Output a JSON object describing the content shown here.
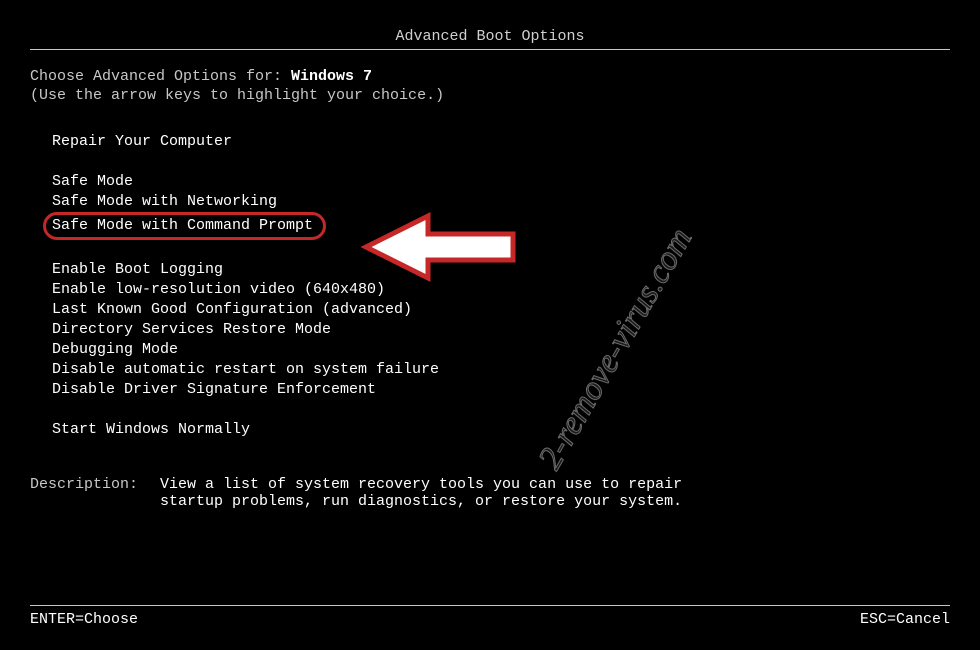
{
  "title": "Advanced Boot Options",
  "intro": {
    "prefix": "Choose Advanced Options for: ",
    "os": "Windows 7",
    "hint": "(Use the arrow keys to highlight your choice.)"
  },
  "menu": {
    "group1": [
      "Repair Your Computer"
    ],
    "group2": [
      "Safe Mode",
      "Safe Mode with Networking",
      "Safe Mode with Command Prompt"
    ],
    "group3": [
      "Enable Boot Logging",
      "Enable low-resolution video (640x480)",
      "Last Known Good Configuration (advanced)",
      "Directory Services Restore Mode",
      "Debugging Mode",
      "Disable automatic restart on system failure",
      "Disable Driver Signature Enforcement"
    ],
    "group4": [
      "Start Windows Normally"
    ],
    "highlighted_index": {
      "group": 2,
      "item": 2
    }
  },
  "description": {
    "label": "Description:",
    "text": "View a list of system recovery tools you can use to repair startup problems, run diagnostics, or restore your system."
  },
  "footer": {
    "enter": "ENTER=Choose",
    "esc": "ESC=Cancel"
  },
  "annotation": {
    "watermark": "2-remove-virus.com",
    "highlight_color": "#c62828"
  }
}
